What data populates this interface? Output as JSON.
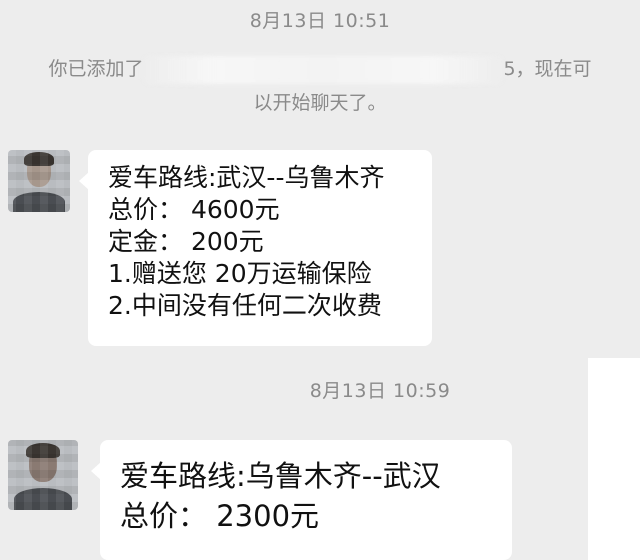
{
  "chat": {
    "timestamp_1": "8月13日 10:51",
    "system_notice": {
      "prefix": "你已添加了",
      "redacted_tail": "5",
      "suffix": "，现在可",
      "line2": "以开始聊天了。"
    },
    "message_1": {
      "lines": [
        "爱车路线:武汉--乌鲁木齐",
        "总价：  4600元",
        "定金：  200元",
        "1.赠送您 20万运输保险",
        "2.中间没有任何二次收费"
      ]
    },
    "timestamp_2": "8月13日 10:59",
    "message_2": {
      "lines": [
        "爱车路线:乌鲁木齐--武汉",
        "总价：  2300元"
      ]
    }
  }
}
